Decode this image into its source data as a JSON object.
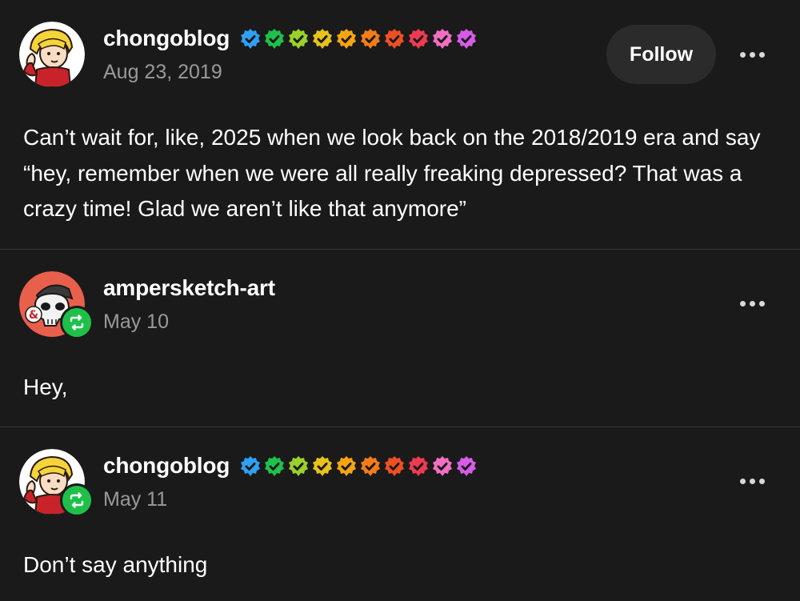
{
  "posts": [
    {
      "username": "chongoblog",
      "date": "Aug 23, 2019",
      "follow_label": "Follow",
      "avatar_icon": "cartoon-avatar-blonde",
      "badge_colors": [
        "#2ea1f5",
        "#1ec24a",
        "#9ad12a",
        "#e8c21a",
        "#f5a512",
        "#f47c16",
        "#ee5023",
        "#ee3b52",
        "#f26ec3",
        "#d75be8"
      ],
      "body": "Can’t wait for, like, 2025 when we look back on the 2018/2019 era and say “hey, remember when we were all really freaking depressed? That was a crazy time! Glad we aren’t like that anymore”"
    },
    {
      "username": "ampersketch-art",
      "date": "May 10",
      "avatar_icon": "skull-avatar-ampersand",
      "reblog_icon": "reblog-icon",
      "body": "Hey,"
    },
    {
      "username": "chongoblog",
      "date": "May 11",
      "avatar_icon": "cartoon-avatar-blonde",
      "reblog_icon": "reblog-icon",
      "badge_colors": [
        "#2ea1f5",
        "#1ec24a",
        "#9ad12a",
        "#e8c21a",
        "#f5a512",
        "#f47c16",
        "#ee5023",
        "#ee3b52",
        "#f26ec3",
        "#d75be8"
      ],
      "body": "Don’t say anything"
    }
  ],
  "colors": {
    "background": "#1a1a1a",
    "reblog_green": "#1fc04a",
    "date_gray": "#9a9a9a"
  }
}
